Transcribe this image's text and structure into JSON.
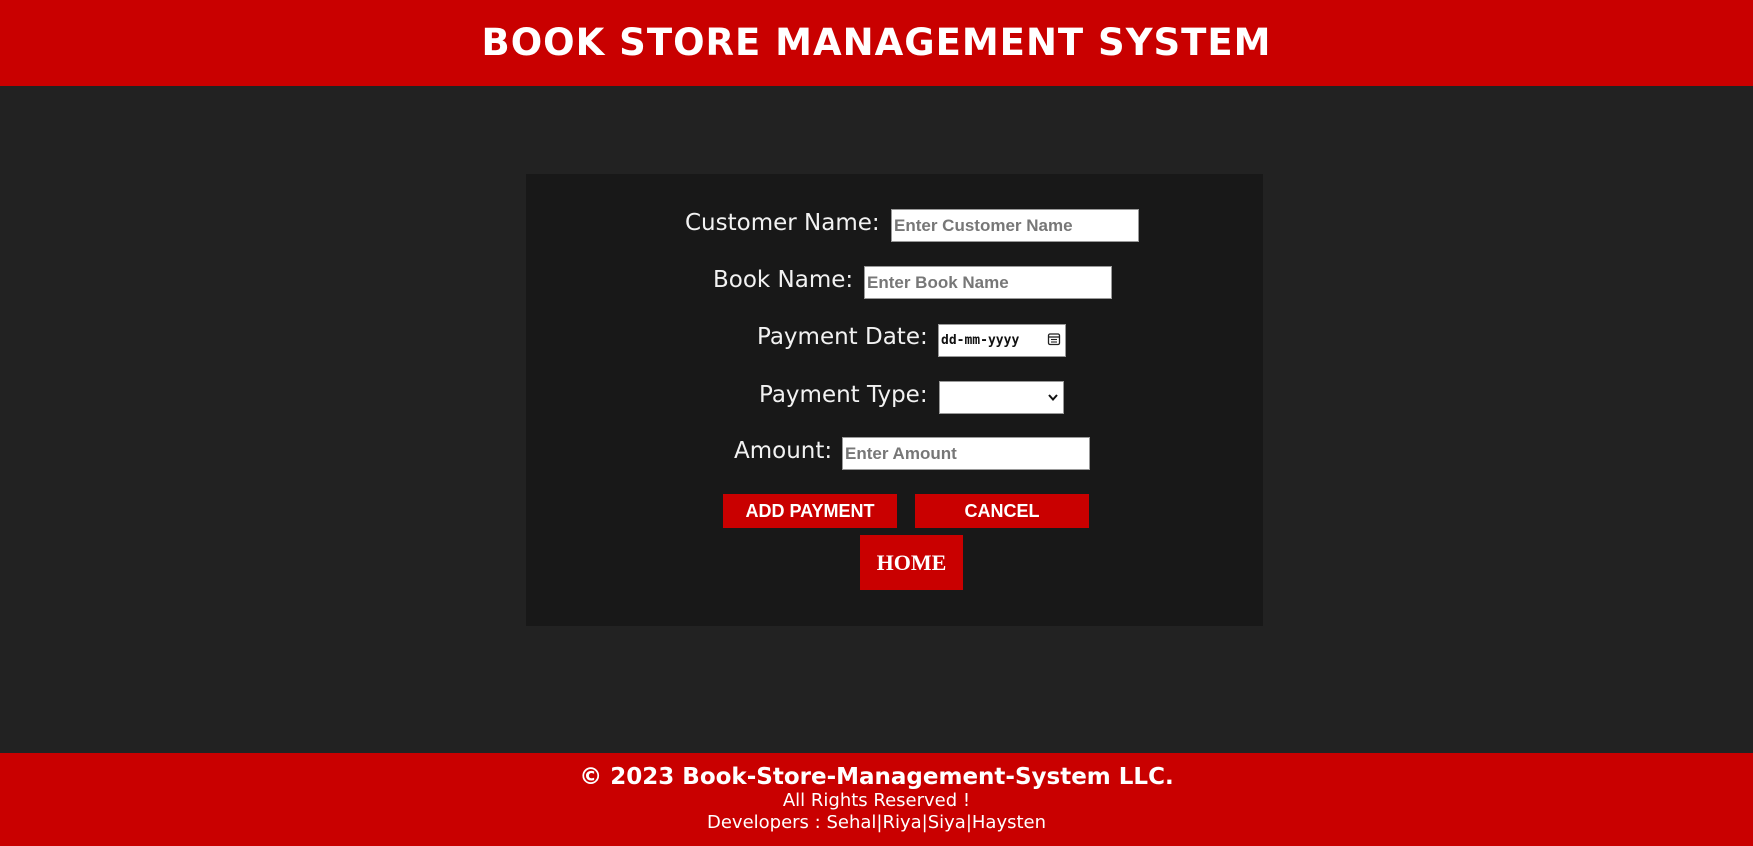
{
  "header": {
    "title": "BOOK STORE MANAGEMENT SYSTEM"
  },
  "form": {
    "customer_name": {
      "label": "Customer Name:",
      "placeholder": "Enter Customer Name",
      "value": ""
    },
    "book_name": {
      "label": "Book Name:",
      "placeholder": "Enter Book Name",
      "value": ""
    },
    "payment_date": {
      "label": "Payment Date:",
      "display": "dd-mm-yyyy",
      "icon": "calendar-icon"
    },
    "payment_type": {
      "label": "Payment Type:",
      "selected": "",
      "icon": "chevron-down-icon"
    },
    "amount": {
      "label": "Amount:",
      "placeholder": "Enter Amount",
      "value": ""
    },
    "buttons": {
      "add": "ADD PAYMENT",
      "cancel": "CANCEL",
      "home": "HOME"
    }
  },
  "footer": {
    "copyright": "© 2023 Book-Store-Management-System LLC.",
    "rights": "All Rights Reserved !",
    "developers": "Developers : Sehal|Riya|Siya|Haysten"
  },
  "colors": {
    "accent": "#c90000",
    "background": "#222222",
    "panel": "#181818"
  }
}
